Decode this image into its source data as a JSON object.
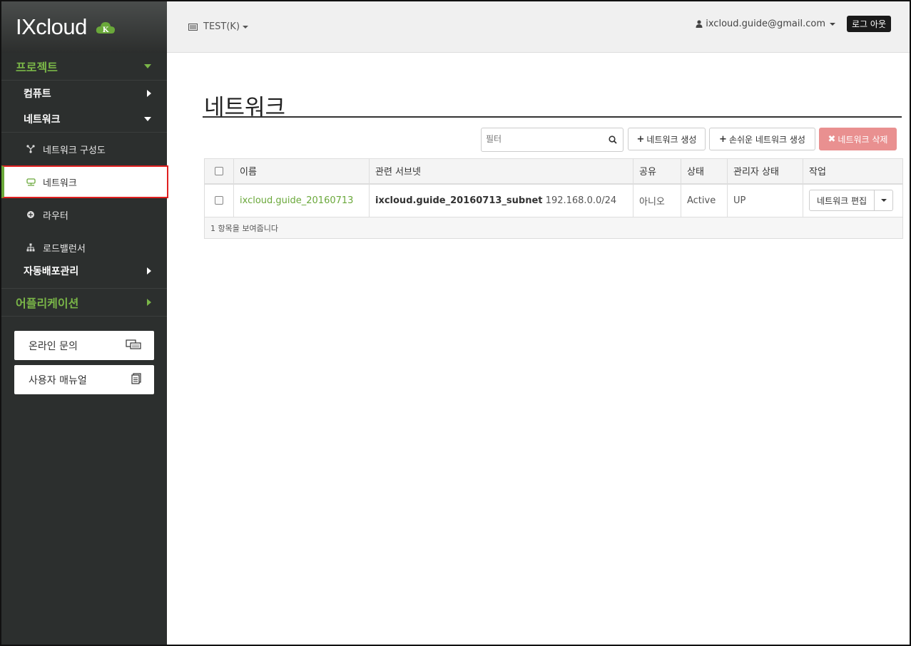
{
  "brand": {
    "name": "IXcloud",
    "badge": "K"
  },
  "sidebar": {
    "project_label": "프로젝트",
    "compute_label": "컴퓨트",
    "network_label": "네트워크",
    "items": [
      {
        "label": "네트워크 구성도",
        "icon": "topology-icon"
      },
      {
        "label": "네트워크",
        "icon": "network-icon"
      },
      {
        "label": "라우터",
        "icon": "router-icon"
      },
      {
        "label": "로드밸런서",
        "icon": "load-balancer-icon"
      }
    ],
    "auto_deploy_label": "자동배포관리",
    "application_label": "어플리케이션",
    "online_inquiry_label": "온라인 문의",
    "user_manual_label": "사용자 매뉴얼"
  },
  "topbar": {
    "project": "TEST(K)",
    "user_email": "ixcloud.guide@gmail.com",
    "logout_label": "로그 아웃"
  },
  "main": {
    "title": "네트워크",
    "filter_placeholder": "필터",
    "create_label": "네트워크 생성",
    "easy_create_label": "손쉬운 네트워크 생성",
    "delete_label": "네트워크 삭제",
    "columns": [
      "이름",
      "관련 서브넷",
      "공유",
      "상태",
      "관리자 상태",
      "작업"
    ],
    "rows": [
      {
        "name": "ixcloud.guide_20160713",
        "subnet_name": "ixcloud.guide_20160713_subnet",
        "subnet_cidr": "192.168.0.0/24",
        "shared": "아니오",
        "status": "Active",
        "admin_state": "UP",
        "action_label": "네트워크 편집"
      }
    ],
    "footer": "1 항목을 보여줍니다"
  },
  "colors": {
    "accent": "#6aa83a",
    "danger": "#e99090",
    "sidebar_bg": "#2c2f2e"
  }
}
